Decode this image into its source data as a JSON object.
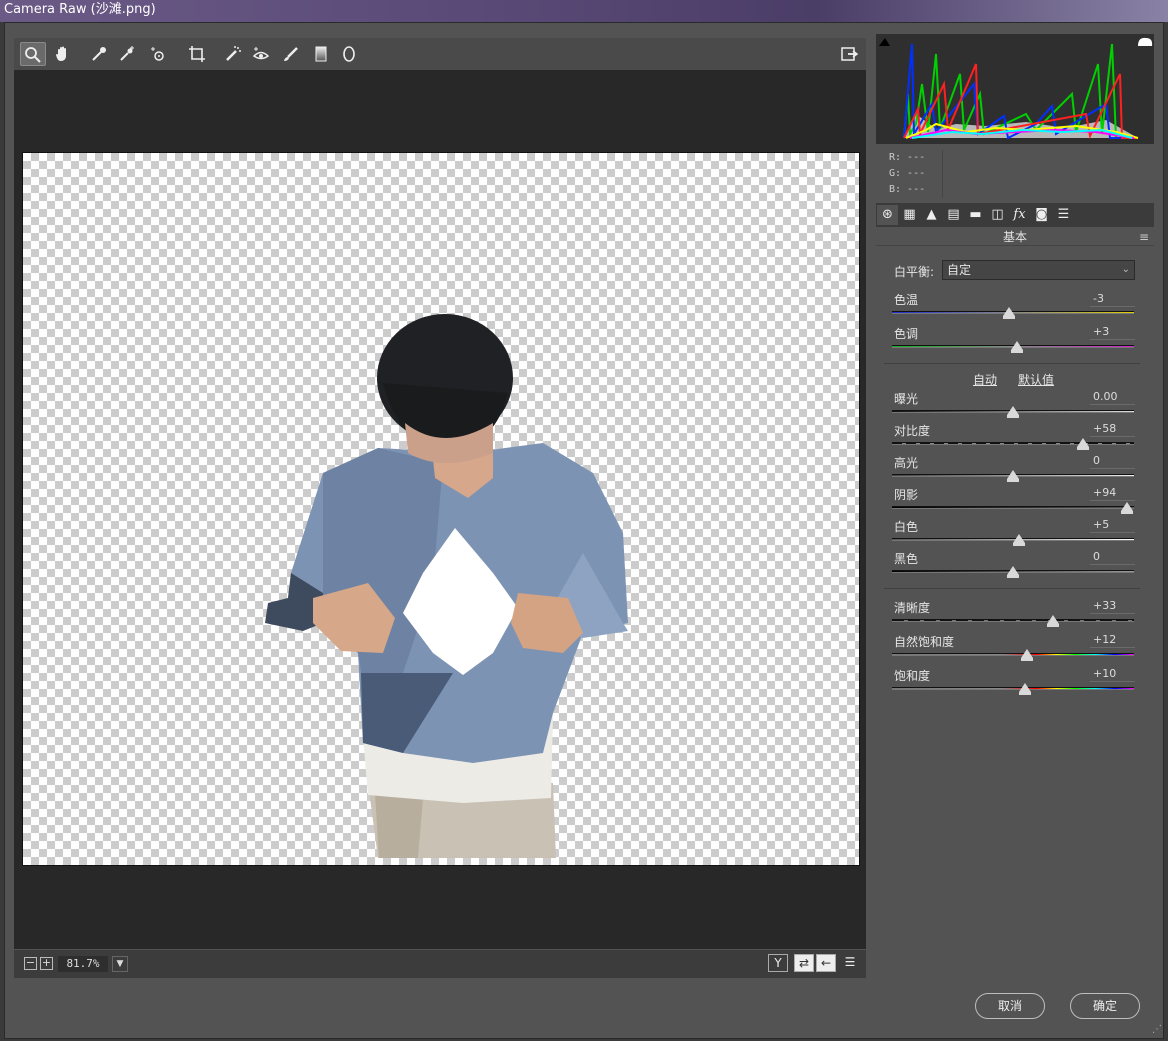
{
  "window": {
    "title": "Camera Raw (沙滩.png)"
  },
  "toolbar": {
    "tools": [
      "zoom-icon",
      "hand-icon",
      "white-balance-icon",
      "color-sampler-icon",
      "target-adjust-icon",
      "crop-icon",
      "spot-removal-icon",
      "red-eye-icon",
      "brush-icon",
      "graduated-filter-icon",
      "radial-filter-icon"
    ],
    "open_prefs_icon": "export-icon"
  },
  "readout": {
    "r": "R: ---",
    "g": "G: ---",
    "b": "B: ---"
  },
  "panel": {
    "title": "基本",
    "wb_label": "白平衡:",
    "wb_value": "自定",
    "auto_label": "自动",
    "default_label": "默认值"
  },
  "sliders": {
    "temperature": {
      "label": "色温",
      "value": "-3"
    },
    "tint": {
      "label": "色调",
      "value": "+3"
    },
    "exposure": {
      "label": "曝光",
      "value": "0.00"
    },
    "contrast": {
      "label": "对比度",
      "value": "+58"
    },
    "highlights": {
      "label": "高光",
      "value": "0"
    },
    "shadows": {
      "label": "阴影",
      "value": "+94"
    },
    "whites": {
      "label": "白色",
      "value": "+5"
    },
    "blacks": {
      "label": "黑色",
      "value": "0"
    },
    "clarity": {
      "label": "清晰度",
      "value": "+33"
    },
    "vibrance": {
      "label": "自然饱和度",
      "value": "+12"
    },
    "saturation": {
      "label": "饱和度",
      "value": "+10"
    }
  },
  "status": {
    "zoom": "81.7%"
  },
  "buttons": {
    "cancel": "取消",
    "ok": "确定"
  },
  "colors": {
    "accent": "#535353",
    "canvas": "#282828"
  }
}
